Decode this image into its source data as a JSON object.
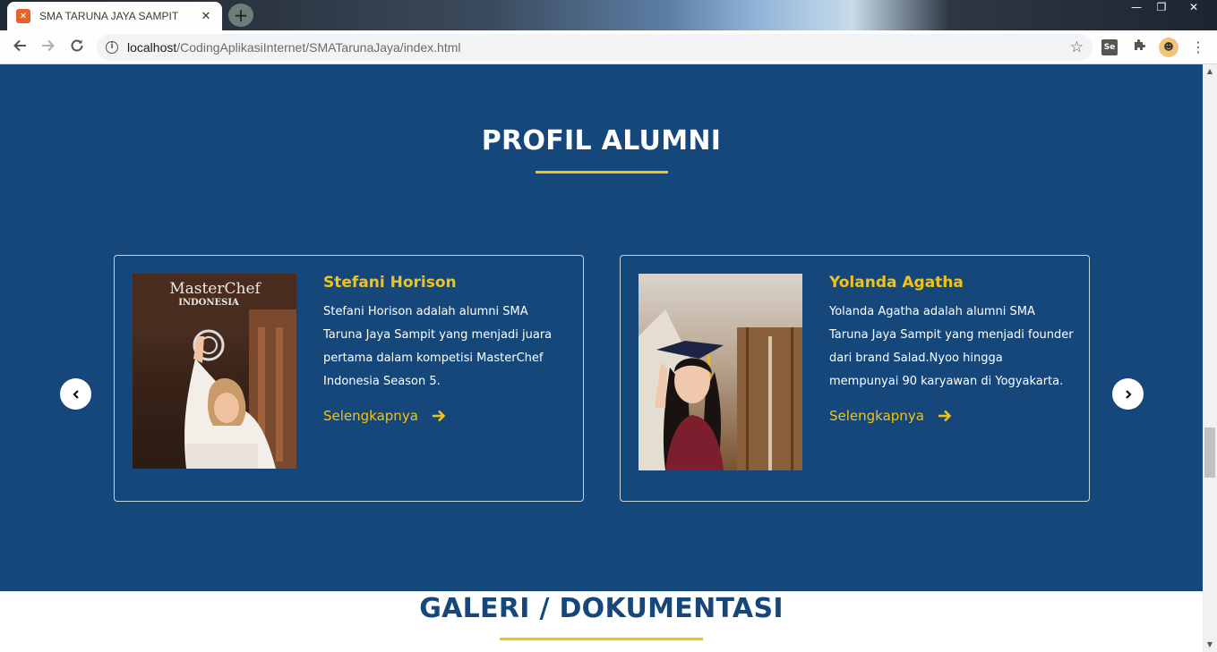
{
  "browser": {
    "tab_title": "SMA TARUNA JAYA SAMPIT",
    "url_host": "localhost",
    "url_path": "/CodingAplikasiInternet/SMATarunaJaya/index.html"
  },
  "alumni_section": {
    "title": "PROFIL ALUMNI",
    "cards": [
      {
        "name": "Stefani Horison",
        "description": "Stefani Horison adalah alumni SMA Taruna Jaya Sampit yang menjadi juara pertama dalam kompetisi MasterChef Indonesia Season 5.",
        "link_label": "Selengkapnya",
        "photo_sign": "MasterChef",
        "photo_sign_sub": "INDONESIA"
      },
      {
        "name": "Yolanda Agatha",
        "description": "Yolanda Agatha adalah alumni SMA Taruna Jaya Sampit yang menjadi founder dari brand Salad.Nyoo hingga mempunyai 90 karyawan di Yogyakarta.",
        "link_label": "Selengkapnya"
      }
    ]
  },
  "gallery_section": {
    "title": "GALERI / DOKUMENTASI"
  },
  "colors": {
    "section_bg": "#16477a",
    "accent": "#f2c317"
  }
}
